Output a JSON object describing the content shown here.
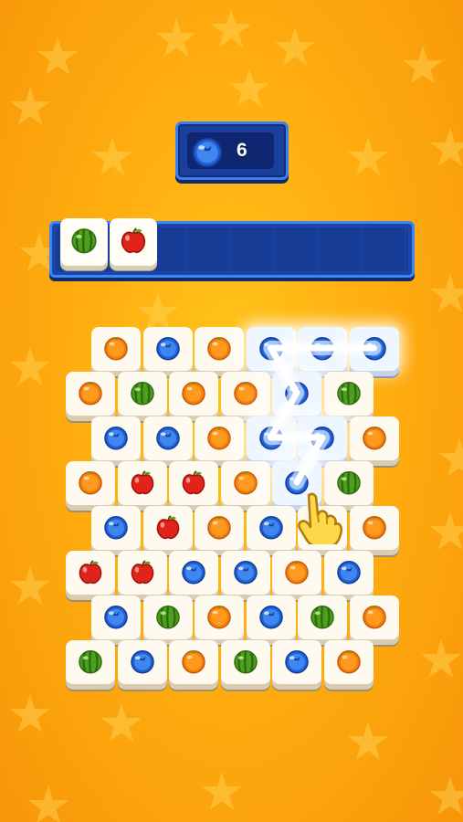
{
  "counter": {
    "icon": "blueberry-icon",
    "value": "6"
  },
  "tray": {
    "slots": [
      {
        "fruit": "watermelon"
      },
      {
        "fruit": "apple"
      }
    ],
    "capacity_slots": 7
  },
  "board": {
    "rows": [
      [
        "orange",
        "blueberry",
        "orange",
        "blueberry",
        "blueberry",
        "blueberry"
      ],
      [
        "orange",
        "watermelon",
        "orange",
        "orange",
        "blueberry",
        "watermelon"
      ],
      [
        "blueberry",
        "blueberry",
        "orange",
        "blueberry",
        "blueberry",
        "orange"
      ],
      [
        "orange",
        "apple",
        "apple",
        "orange",
        "blueberry",
        "watermelon"
      ],
      [
        "blueberry",
        "apple",
        "orange",
        "blueberry",
        "blueberry",
        "orange"
      ],
      [
        "apple",
        "apple",
        "blueberry",
        "blueberry",
        "orange",
        "blueberry"
      ],
      [
        "blueberry",
        "watermelon",
        "orange",
        "blueberry",
        "watermelon",
        "orange"
      ],
      [
        "watermelon",
        "blueberry",
        "orange",
        "watermelon",
        "blueberry",
        "orange"
      ]
    ],
    "highlighted_path": [
      [
        0,
        5
      ],
      [
        0,
        4
      ],
      [
        0,
        3
      ],
      [
        1,
        4
      ],
      [
        2,
        3
      ],
      [
        2,
        4
      ],
      [
        3,
        4
      ]
    ]
  },
  "hint": {
    "icon": "pointing-hand-icon"
  },
  "colors": {
    "background": "#ffae10",
    "panel": "#1d45a8",
    "panel_border": "#3c86f5",
    "tile": "#fffaf0"
  }
}
